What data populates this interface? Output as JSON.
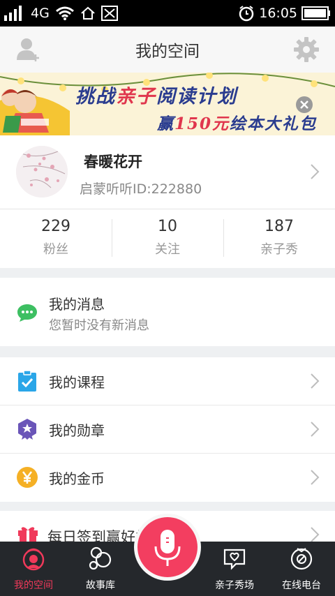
{
  "status_bar": {
    "network": "4G",
    "time": "16:05"
  },
  "header": {
    "title": "我的空间"
  },
  "banner": {
    "line1_part1": "挑战",
    "line1_highlight": "亲子",
    "line1_part2": "阅读计划",
    "line2_part1": "赢",
    "line2_highlight": "150元",
    "line2_part2": "绘本大礼包"
  },
  "profile": {
    "name": "春暖花开",
    "id_text": "启蒙听听ID:222880"
  },
  "stats": [
    {
      "value": "229",
      "label": "粉丝"
    },
    {
      "value": "10",
      "label": "关注"
    },
    {
      "value": "187",
      "label": "亲子秀"
    }
  ],
  "messages": {
    "title": "我的消息",
    "subtitle": "您暂时没有新消息"
  },
  "menu": [
    {
      "label": "我的课程",
      "icon": "clipboard-check-icon",
      "color": "#2aa6e8"
    },
    {
      "label": "我的勋章",
      "icon": "medal-icon",
      "color": "#6a55b8"
    },
    {
      "label": "我的金币",
      "icon": "coin-icon",
      "color": "#f5b025"
    }
  ],
  "signin": {
    "label": "每日签到赢好礼",
    "icon": "gift-icon",
    "color": "#f0395a"
  },
  "tabs": [
    {
      "label": "我的空间",
      "icon": "my-space-icon",
      "active": true
    },
    {
      "label": "故事库",
      "icon": "story-library-icon",
      "active": false
    },
    {
      "label": "亲子秀场",
      "icon": "parent-child-show-icon",
      "active": false
    },
    {
      "label": "在线电台",
      "icon": "online-radio-icon",
      "active": false
    }
  ],
  "colors": {
    "accent": "#f0395a",
    "tabbar_bg": "#25282c",
    "green_chat": "#3dbf62"
  }
}
